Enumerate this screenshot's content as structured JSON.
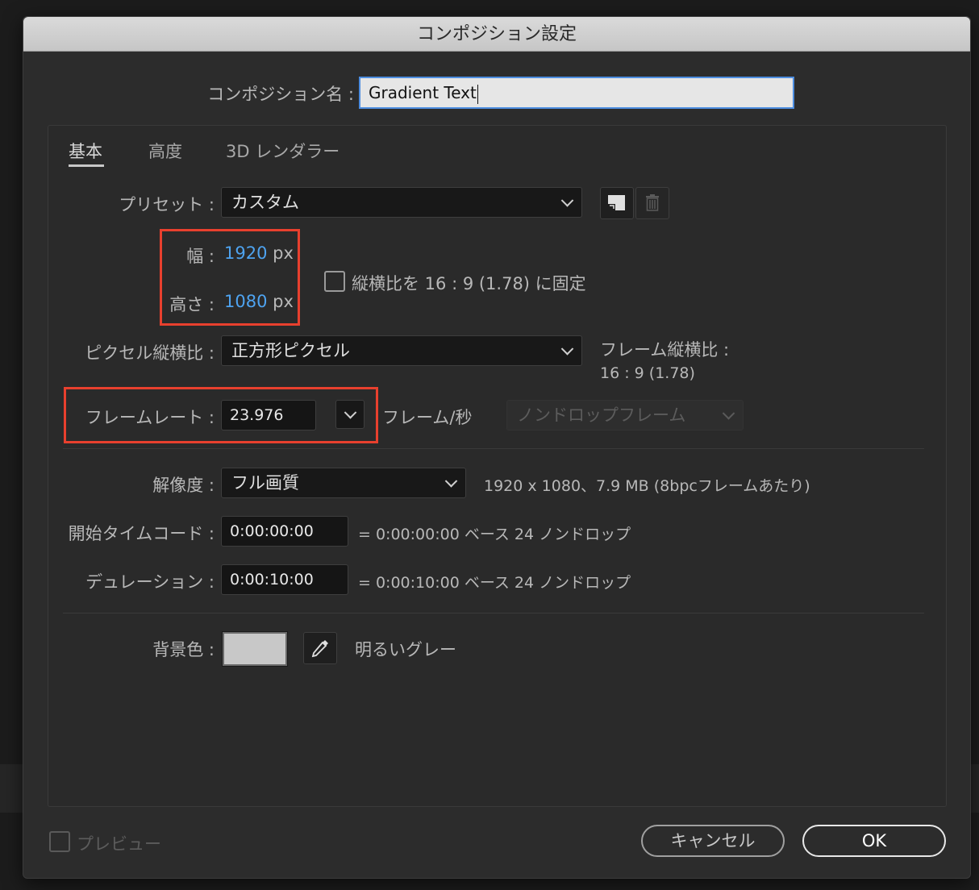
{
  "dialog": {
    "title": "コンポジション設定"
  },
  "name": {
    "label": "コンポジション名 :",
    "value": "Gradient Text"
  },
  "tabs": [
    {
      "label": "基本",
      "active": true
    },
    {
      "label": "高度",
      "active": false
    },
    {
      "label": "3D レンダラー",
      "active": false
    }
  ],
  "preset": {
    "label": "プリセット :",
    "value": "カスタム"
  },
  "width": {
    "label": "幅 :",
    "value": "1920",
    "unit": "px"
  },
  "height": {
    "label": "高さ :",
    "value": "1080",
    "unit": "px"
  },
  "lock_aspect": {
    "label": "縦横比を 16 : 9 (1.78) に固定",
    "checked": false
  },
  "pixel_aspect": {
    "label": "ピクセル縦横比 :",
    "value": "正方形ピクセル"
  },
  "frame_aspect": {
    "label": "フレーム縦横比 :",
    "value": "16 : 9 (1.78)"
  },
  "frame_rate": {
    "label": "フレームレート :",
    "value": "23.976",
    "unit": "フレーム/秒",
    "drop_frame": "ノンドロップフレーム"
  },
  "resolution": {
    "label": "解像度 :",
    "value": "フル画質",
    "info": "1920 x 1080、7.9 MB (8bpcフレームあたり)"
  },
  "start_timecode": {
    "label": "開始タイムコード :",
    "value": "0:00:00:00",
    "info": "= 0:00:00:00  ベース 24  ノンドロップ"
  },
  "duration": {
    "label": "デュレーション :",
    "value": "0:00:10:00",
    "info": "= 0:00:10:00  ベース 24  ノンドロップ"
  },
  "background": {
    "label": "背景色 :",
    "color": "#c8c8c8",
    "name": "明るいグレー"
  },
  "preview": {
    "label": "プレビュー",
    "checked": false
  },
  "buttons": {
    "cancel": "キャンセル",
    "ok": "OK"
  },
  "colors": {
    "accent": "#4ea3f0",
    "highlight": "#e8402e",
    "focus": "#4d8de0"
  }
}
